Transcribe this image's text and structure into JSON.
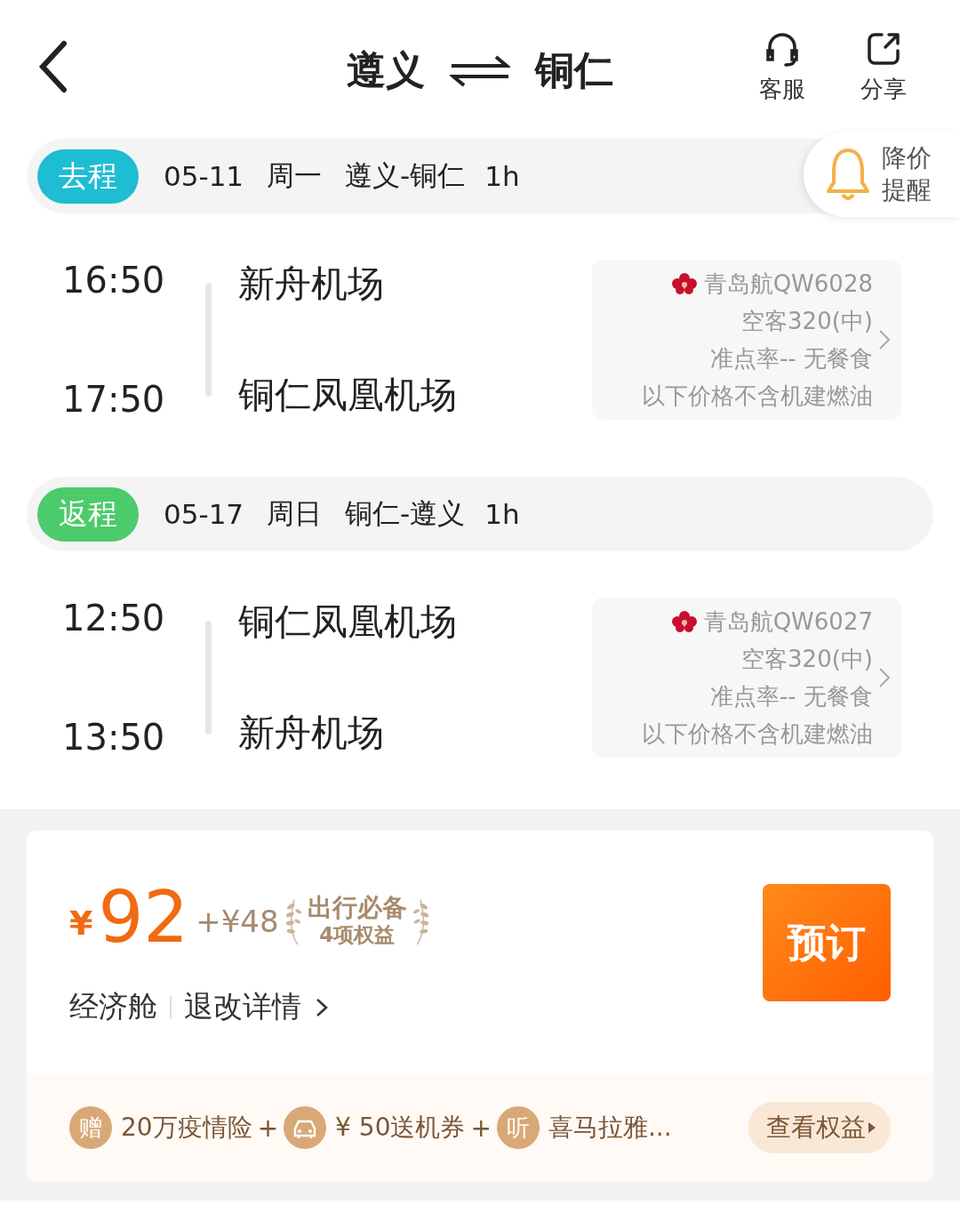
{
  "header": {
    "from": "遵义",
    "to": "铜仁",
    "actions": [
      {
        "kind": "service",
        "label": "客服"
      },
      {
        "kind": "share",
        "label": "分享"
      }
    ]
  },
  "price_alert": {
    "line1": "降价",
    "line2": "提醒"
  },
  "legs": [
    {
      "tag": "去程",
      "color": "#1fbdd3",
      "date": "05-11",
      "weekday": "周一",
      "route": "遵义-铜仁",
      "duration": "1h",
      "dep_time": "16:50",
      "dep_airport": "新舟机场",
      "arr_time": "17:50",
      "arr_airport": "铜仁凤凰机场",
      "flight": "青岛航QW6028",
      "aircraft": "空客320(中)",
      "punctuality": "准点率-- 无餐食",
      "note": "以下价格不含机建燃油"
    },
    {
      "tag": "返程",
      "color": "#4ccb6b",
      "date": "05-17",
      "weekday": "周日",
      "route": "铜仁-遵义",
      "duration": "1h",
      "dep_time": "12:50",
      "dep_airport": "铜仁凤凰机场",
      "arr_time": "13:50",
      "arr_airport": "新舟机场",
      "flight": "青岛航QW6027",
      "aircraft": "空客320(中)",
      "punctuality": "准点率-- 无餐食",
      "note": "以下价格不含机建燃油"
    }
  ],
  "offer": {
    "currency": "¥",
    "price": "92",
    "extra": "+¥48",
    "badge_title": "出行必备",
    "badge_sub": "4项权益",
    "cabin": "经济舱",
    "rules": "退改详情",
    "book": "预订"
  },
  "perks": [
    {
      "icon": "赠",
      "text": "20万疫情险",
      "sep": "+"
    },
    {
      "kind": "car",
      "text": "¥ 50送机券",
      "sep": "+"
    },
    {
      "icon": "听",
      "text": "喜马拉雅..."
    }
  ],
  "perks_button": "查看权益"
}
